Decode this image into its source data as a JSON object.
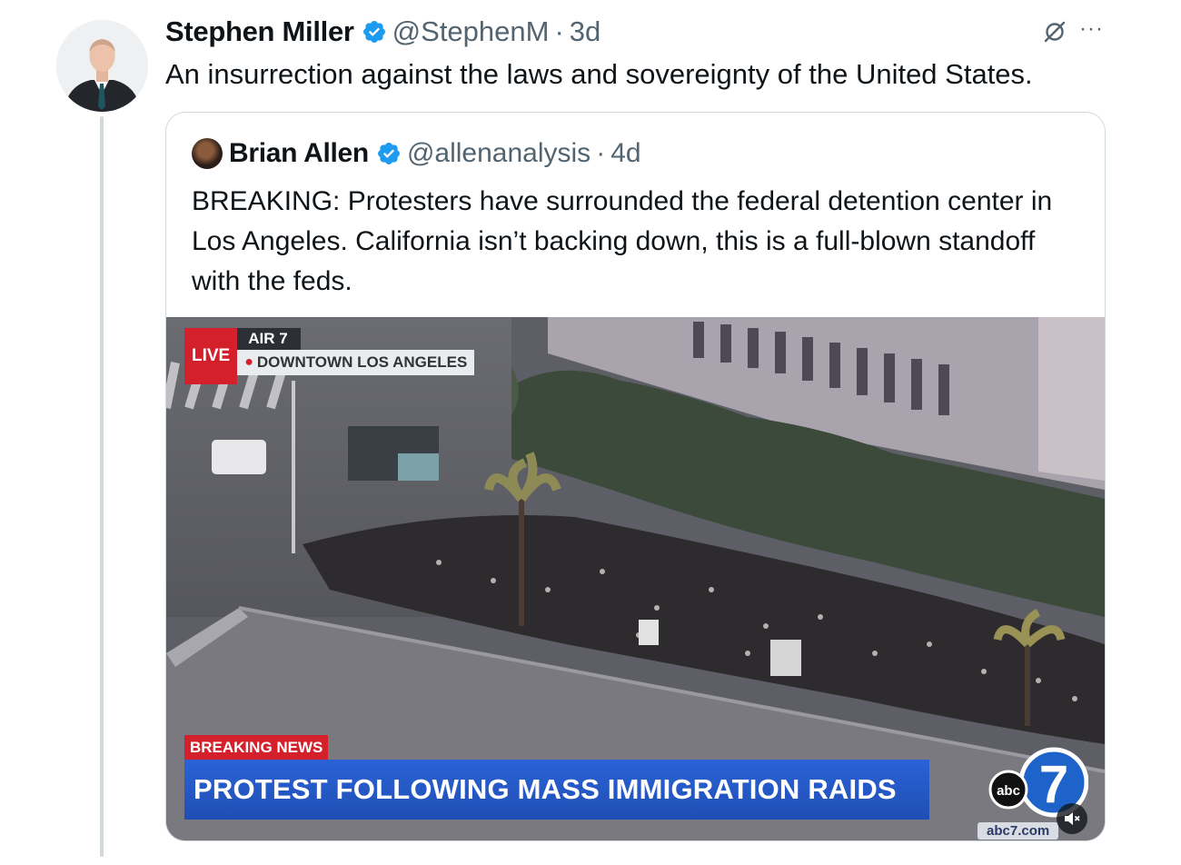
{
  "tweet": {
    "author_name": "Stephen Miller",
    "handle": "@StephenM",
    "separator": "·",
    "time": "3d",
    "more_label": "···",
    "text": "An insurrection against the laws and sovereignty of the United States."
  },
  "quote": {
    "author_name": "Brian Allen",
    "handle": "@allenanalysis",
    "separator": "·",
    "time": "4d",
    "text": "BREAKING: Protesters have surrounded the federal detention center in Los Angeles. California isn’t backing down, this is a full-blown standoff with the feds.",
    "media": {
      "live_label": "LIVE",
      "air_label": "AIR 7",
      "location": "DOWNTOWN LOS ANGELES",
      "breaking_label": "BREAKING NEWS",
      "headline": "PROTEST FOLLOWING MASS IMMIGRATION RAIDS",
      "network_logo": "abc",
      "network_logo_number": "7",
      "network_site": "abc7.com"
    }
  },
  "colors": {
    "verified": "#1d9bf0",
    "secondary_text": "#536471",
    "border": "#cfd9de",
    "live_red": "#d4202a",
    "lower_third_blue": "#2a62d6"
  },
  "icons": [
    "verified-badge-icon",
    "grok-icon",
    "more-icon",
    "mute-icon",
    "location-pin-icon"
  ]
}
